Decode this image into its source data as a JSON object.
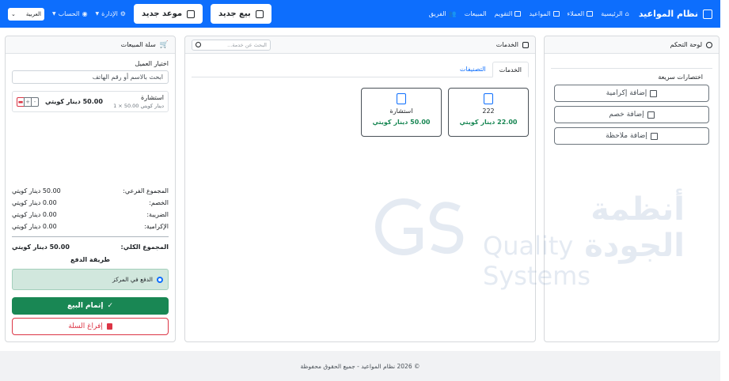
{
  "navbar": {
    "brand": "نظام المواعيد",
    "links": [
      {
        "label": "الرئيسية",
        "icon": "home-icon"
      },
      {
        "label": "العملاء",
        "icon": "id-card-icon"
      },
      {
        "label": "المواعيد",
        "icon": "calendar-icon"
      },
      {
        "label": "التقويم",
        "icon": "calendar-grid-icon"
      },
      {
        "label": "المبيعات",
        "icon": "cart-icon"
      },
      {
        "label": "الفريق",
        "icon": "people-icon"
      }
    ],
    "admin_label": "الإدارة",
    "account_label": "الحساب",
    "language": "العربية",
    "new_sale": "بيع جديد",
    "new_appointment": "موعد جديد"
  },
  "control_panel": {
    "title": "لوحة التحكم",
    "quick_title": "اختصارات سريعة",
    "buttons": [
      "إضافة إكرامية",
      "إضافة خصم",
      "إضافة ملاحظة"
    ]
  },
  "services_panel": {
    "title": "الخدمات",
    "search_placeholder": "البحث عن خدمة...",
    "tabs": [
      "الخدمات",
      "التصنيفات"
    ],
    "cards": [
      {
        "name": "222",
        "price": "22.00 دينار كويتي"
      },
      {
        "name": "استشارة",
        "price": "50.00 دينار كويتي"
      }
    ]
  },
  "cart": {
    "title": "سلة المبيعات",
    "choose_customer": "اختيار العميل",
    "customer_placeholder": "ابحث بالاسم أو رقم الهاتف",
    "item": {
      "name": "استشارة",
      "detail": "دينار كويتي 50.00 × 1",
      "total": "50.00 دينار كويتي"
    },
    "subtotal_label": "المجموع الفرعي:",
    "subtotal": "50.00 دينار كويتي",
    "discount_label": "الخصم:",
    "discount": "0.00 دينار كويتي",
    "tax_label": "الضريبة:",
    "tax": "0.00 دينار كويتي",
    "tip_label": "الإكرامية:",
    "tip": "0.00 دينار كويتي",
    "grand_label": "المجموع الكلي:",
    "grand": "50.00 دينار كويتي",
    "payment_title": "طريقة الدفع",
    "payment_option": "الدفع في المركز",
    "complete": "إتمام البيع",
    "clear": "إفراغ السلة"
  },
  "watermark": {
    "ar": "أنظمة الجودة",
    "en": "Quality Systems"
  },
  "footer": "© 2026 نظام المواعيد - جميع الحقوق محفوظة"
}
